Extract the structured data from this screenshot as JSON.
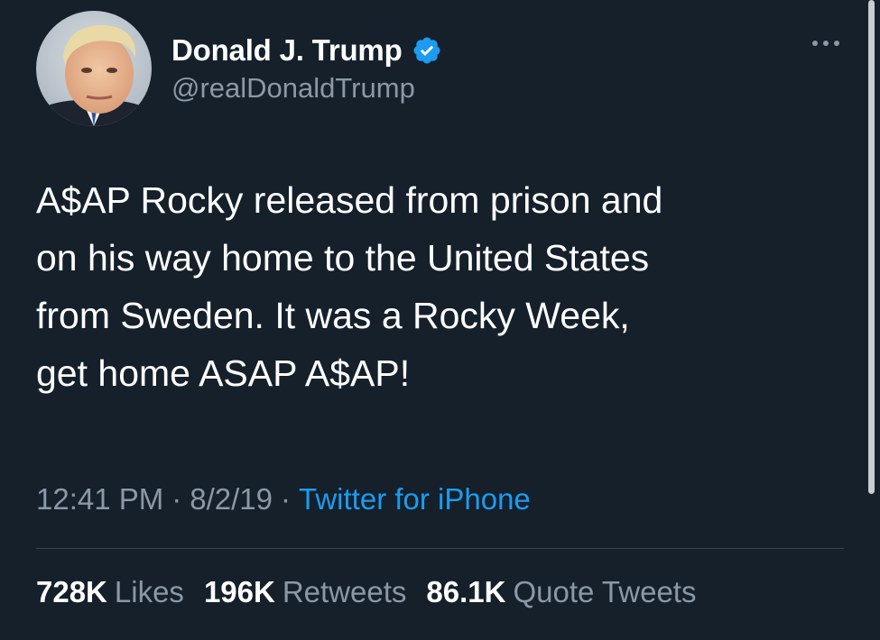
{
  "colors": {
    "background": "#15202b",
    "primary_text": "#ffffff",
    "secondary_text": "#8b98a5",
    "accent": "#1d9bf0",
    "divider": "#38444d"
  },
  "user": {
    "display_name": "Donald J. Trump",
    "handle": "@realDonaldTrump",
    "verified_icon": "verified-badge-icon",
    "avatar_icon": "avatar-photo"
  },
  "header": {
    "more_icon": "more-horizontal-icon"
  },
  "tweet": {
    "text": "A$AP Rocky released from prison and\non his way home to the United States\nfrom Sweden. It was a Rocky Week,\nget home ASAP A$AP!",
    "time": "12:41 PM",
    "date": "8/2/19",
    "separator": "·",
    "source": "Twitter for iPhone"
  },
  "stats": [
    {
      "count": "728K",
      "label": "Likes"
    },
    {
      "count": "196K",
      "label": "Retweets"
    },
    {
      "count": "86.1K",
      "label": "Quote Tweets"
    }
  ]
}
